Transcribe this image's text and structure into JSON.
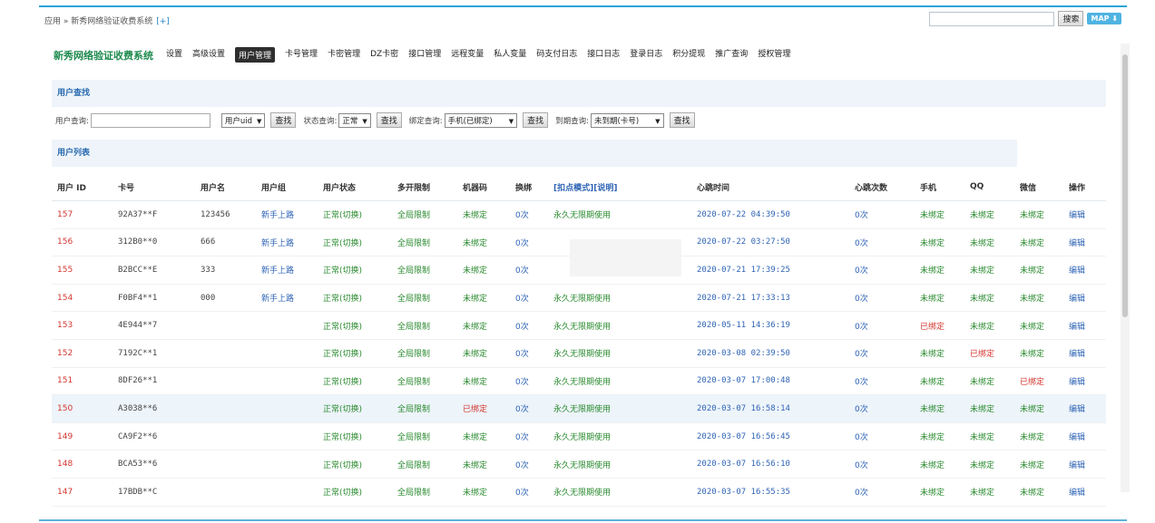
{
  "breadcrumb": "应用 » 新秀网络验证收费系统",
  "breadcrumb_plus": "[+]",
  "search_button": "搜索",
  "map_button": "MAP ⬇",
  "app_title": "新秀网络验证收费系统",
  "nav": [
    "设置",
    "高级设置",
    "用户管理",
    "卡号管理",
    "卡密管理",
    "DZ卡密",
    "接口管理",
    "远程变量",
    "私人变量",
    "码支付日志",
    "接口日志",
    "登录日志",
    "积分提现",
    "推广查询",
    "授权管理"
  ],
  "active_nav": "用户管理",
  "search_section_title": "用户查找",
  "search": {
    "user_query_label": "用户查询:",
    "user_query_value": "",
    "field_select": "用户uid",
    "find_label": "查找",
    "status_label": "状态查询:",
    "status_value": "正常",
    "bind_label": "绑定查询:",
    "bind_value": "手机(已绑定)",
    "expire_label": "到期查询:",
    "expire_value": "未到期(卡号)"
  },
  "list_section_title": "用户列表",
  "columns": [
    "用户 ID",
    "卡号",
    "用户名",
    "用户组",
    "用户状态",
    "多开限制",
    "机器码",
    "换绑",
    "[扣点模式]",
    "[说明]",
    "心跳时间",
    "心跳次数",
    "手机",
    "QQ",
    "微信",
    "操作"
  ],
  "rows": [
    {
      "id": "157",
      "card": "92A37**F",
      "user": "123456",
      "group": "新手上路",
      "status": "正常(切换)",
      "multi": "全局限制",
      "machine": "未绑定",
      "rebind": "0次",
      "mode": "永久无限期使用",
      "heartbeat": "2020-07-22 04:39:50",
      "count": "0次",
      "phone": "未绑定",
      "qq": "未绑定",
      "wx": "未绑定",
      "op": "编辑"
    },
    {
      "id": "156",
      "card": "312B0**0",
      "user": "666",
      "group": "新手上路",
      "status": "正常(切换)",
      "multi": "全局限制",
      "machine": "未绑定",
      "rebind": "0次",
      "mode": "",
      "heartbeat": "2020-07-22 03:27:50",
      "count": "0次",
      "phone": "未绑定",
      "qq": "未绑定",
      "wx": "未绑定",
      "op": "编辑"
    },
    {
      "id": "155",
      "card": "B2BCC**E",
      "user": "333",
      "group": "新手上路",
      "status": "正常(切换)",
      "multi": "全局限制",
      "machine": "未绑定",
      "rebind": "0次",
      "mode": "",
      "heartbeat": "2020-07-21 17:39:25",
      "count": "0次",
      "phone": "未绑定",
      "qq": "未绑定",
      "wx": "未绑定",
      "op": "编辑"
    },
    {
      "id": "154",
      "card": "F0BF4**1",
      "user": "000",
      "group": "新手上路",
      "status": "正常(切换)",
      "multi": "全局限制",
      "machine": "未绑定",
      "rebind": "0次",
      "mode": "永久无限期使用",
      "heartbeat": "2020-07-21 17:33:13",
      "count": "0次",
      "phone": "未绑定",
      "qq": "未绑定",
      "wx": "未绑定",
      "op": "编辑"
    },
    {
      "id": "153",
      "card": "4E944**7",
      "user": "",
      "group": "",
      "status": "正常(切换)",
      "multi": "全局限制",
      "machine": "未绑定",
      "rebind": "0次",
      "mode": "永久无限期使用",
      "heartbeat": "2020-05-11 14:36:19",
      "count": "0次",
      "phone": "已绑定",
      "qq": "未绑定",
      "wx": "未绑定",
      "op": "编辑"
    },
    {
      "id": "152",
      "card": "7192C**1",
      "user": "",
      "group": "",
      "status": "正常(切换)",
      "multi": "全局限制",
      "machine": "未绑定",
      "rebind": "0次",
      "mode": "永久无限期使用",
      "heartbeat": "2020-03-08 02:39:50",
      "count": "0次",
      "phone": "未绑定",
      "qq": "已绑定",
      "wx": "未绑定",
      "op": "编辑"
    },
    {
      "id": "151",
      "card": "8DF26**1",
      "user": "",
      "group": "",
      "status": "正常(切换)",
      "multi": "全局限制",
      "machine": "未绑定",
      "rebind": "0次",
      "mode": "永久无限期使用",
      "heartbeat": "2020-03-07 17:00:48",
      "count": "0次",
      "phone": "未绑定",
      "qq": "未绑定",
      "wx": "已绑定",
      "op": "编辑"
    },
    {
      "id": "150",
      "card": "A3038**6",
      "user": "",
      "group": "",
      "status": "正常(切换)",
      "multi": "全局限制",
      "machine": "已绑定",
      "rebind": "0次",
      "mode": "永久无限期使用",
      "heartbeat": "2020-03-07 16:58:14",
      "count": "0次",
      "phone": "未绑定",
      "qq": "未绑定",
      "wx": "未绑定",
      "op": "编辑"
    },
    {
      "id": "149",
      "card": "CA9F2**6",
      "user": "",
      "group": "",
      "status": "正常(切换)",
      "multi": "全局限制",
      "machine": "未绑定",
      "rebind": "0次",
      "mode": "永久无限期使用",
      "heartbeat": "2020-03-07 16:56:45",
      "count": "0次",
      "phone": "未绑定",
      "qq": "未绑定",
      "wx": "未绑定",
      "op": "编辑"
    },
    {
      "id": "148",
      "card": "BCA53**6",
      "user": "",
      "group": "",
      "status": "正常(切换)",
      "multi": "全局限制",
      "machine": "未绑定",
      "rebind": "0次",
      "mode": "永久无限期使用",
      "heartbeat": "2020-03-07 16:56:10",
      "count": "0次",
      "phone": "未绑定",
      "qq": "未绑定",
      "wx": "未绑定",
      "op": "编辑"
    },
    {
      "id": "147",
      "card": "17BDB**C",
      "user": "",
      "group": "",
      "status": "正常(切换)",
      "multi": "全局限制",
      "machine": "未绑定",
      "rebind": "0次",
      "mode": "永久无限期使用",
      "heartbeat": "2020-03-07 16:55:35",
      "count": "0次",
      "phone": "未绑定",
      "qq": "未绑定",
      "wx": "未绑定",
      "op": "编辑"
    }
  ],
  "highlight_row_id": "150",
  "colors": {
    "accent": "#2aa6d6",
    "title_green": "#1e8a4e",
    "red": "#d3362f",
    "green": "#2a8a2f",
    "blue": "#2f64b5"
  }
}
